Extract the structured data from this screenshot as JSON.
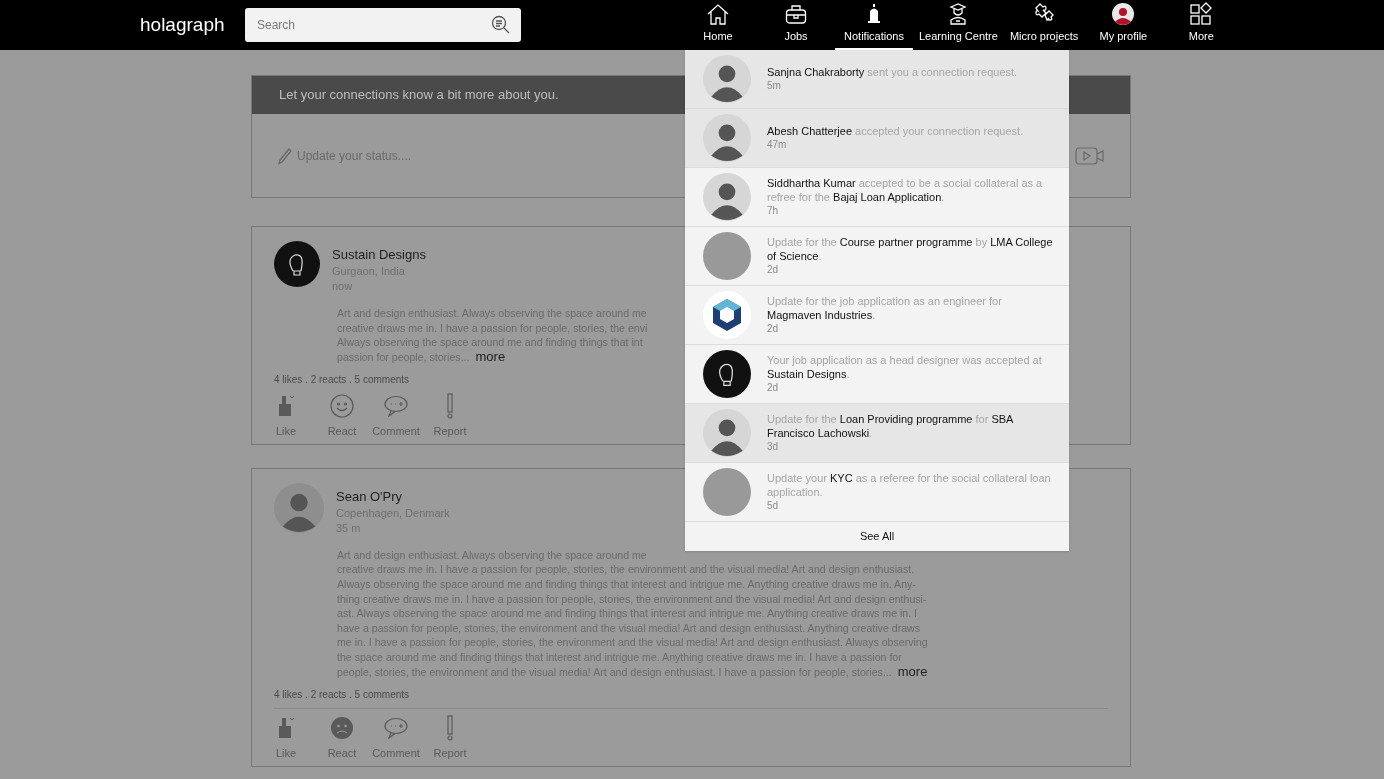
{
  "header": {
    "logo": "holagraph",
    "search": {
      "placeholder": "Search"
    },
    "nav": [
      {
        "label": "Home",
        "selected": false
      },
      {
        "label": "Jobs",
        "selected": false
      },
      {
        "label": "Notifications",
        "selected": true
      },
      {
        "label": "Learning Centre",
        "selected": false
      },
      {
        "label": "Micro projects",
        "selected": false
      },
      {
        "label": "My profile",
        "selected": false
      },
      {
        "label": "More",
        "selected": false
      }
    ]
  },
  "status_card": {
    "title": "Let your connections know a bit more about you.",
    "placeholder": "Update your status...."
  },
  "posts": [
    {
      "author": "Sustain Designs",
      "location": "Gurgaon, India",
      "time": "now",
      "kind": "company",
      "lines": [
        "Art and design enthusiast. Always observing the space around me",
        "creative draws me in. I have a passion for people, stories, the envi",
        "Always observing the space around me and finding things that int",
        "passion for people, stories..."
      ],
      "more": "more",
      "stats": "4 likes . 2 reacts . 5 comments",
      "reacted": false,
      "actions": [
        "Like",
        "React",
        "Comment",
        "Report"
      ]
    },
    {
      "author": "Sean O'Pry",
      "location": "Copenhagen, Denmark",
      "time": "35 m",
      "kind": "person",
      "lines": [
        "Art and design enthusiast. Always observing the space around me",
        "creative draws me in. I have a passion for people, stories, the environment and the visual media! Art and design enthusiast.",
        "Always observing the space around me and finding things that interest and intrigue me. Anything creative draws me in. Any-",
        "thing creative draws me in. I have a passion for people, stories, the environment and the visual media! Art and design enthusi-",
        "ast. Always observing the space around me and finding things that interest and intrigue me. Anything creative draws me in. I",
        "have a passion for people, stories, the environment and the visual media! Art and design enthusiast. Anything creative draws",
        "me in. I have a passion for people, stories, the environment and the visual media! Art and design enthusiast. Always observing",
        "the space around me and finding things that interest and intrigue me. Anything creative draws me in. I have a passion for",
        "people, stories, the environment and the visual media! Art and design enthusiast. I have a passion for people, stories..."
      ],
      "more": "more",
      "stats": "4 likes . 2 reacts . 5 comments",
      "reacted": true,
      "actions": [
        "Like",
        "React",
        "Comment",
        "Report"
      ]
    }
  ],
  "notifications": {
    "items": [
      {
        "text": "**Sanjna Chakraborty** sent you a connection request.",
        "time": "5m",
        "kind": "person",
        "unread": true
      },
      {
        "text": "**Abesh Chatterjee** accepted your connection request.",
        "time": "47m",
        "kind": "person",
        "unread": true
      },
      {
        "text": "**Siddhartha Kumar** accepted to be a social collateral as a refree for the **Bajaj Loan Application**.",
        "time": "7h",
        "kind": "person",
        "unread": false
      },
      {
        "text": "Update for the **Course partner programme** by **LMA College of Science**.",
        "time": "2d",
        "kind": "blank",
        "unread": false
      },
      {
        "text": "Update for the job application as an engineer  for **Magmaven Industries**.",
        "time": "2d",
        "kind": "cube",
        "unread": false
      },
      {
        "text": "Your job application as a head designer was accepted at **Sustain Designs**.",
        "time": "2d",
        "kind": "company",
        "unread": false
      },
      {
        "text": "Update for the **Loan Providing programme** for **SBA Francisco Lachowski**.",
        "time": "3d",
        "kind": "person",
        "unread": true
      },
      {
        "text": "Update your **KYC** as a referee for the social collateral loan application.",
        "time": "5d",
        "kind": "blank",
        "unread": false
      }
    ],
    "see_all": "See All"
  }
}
